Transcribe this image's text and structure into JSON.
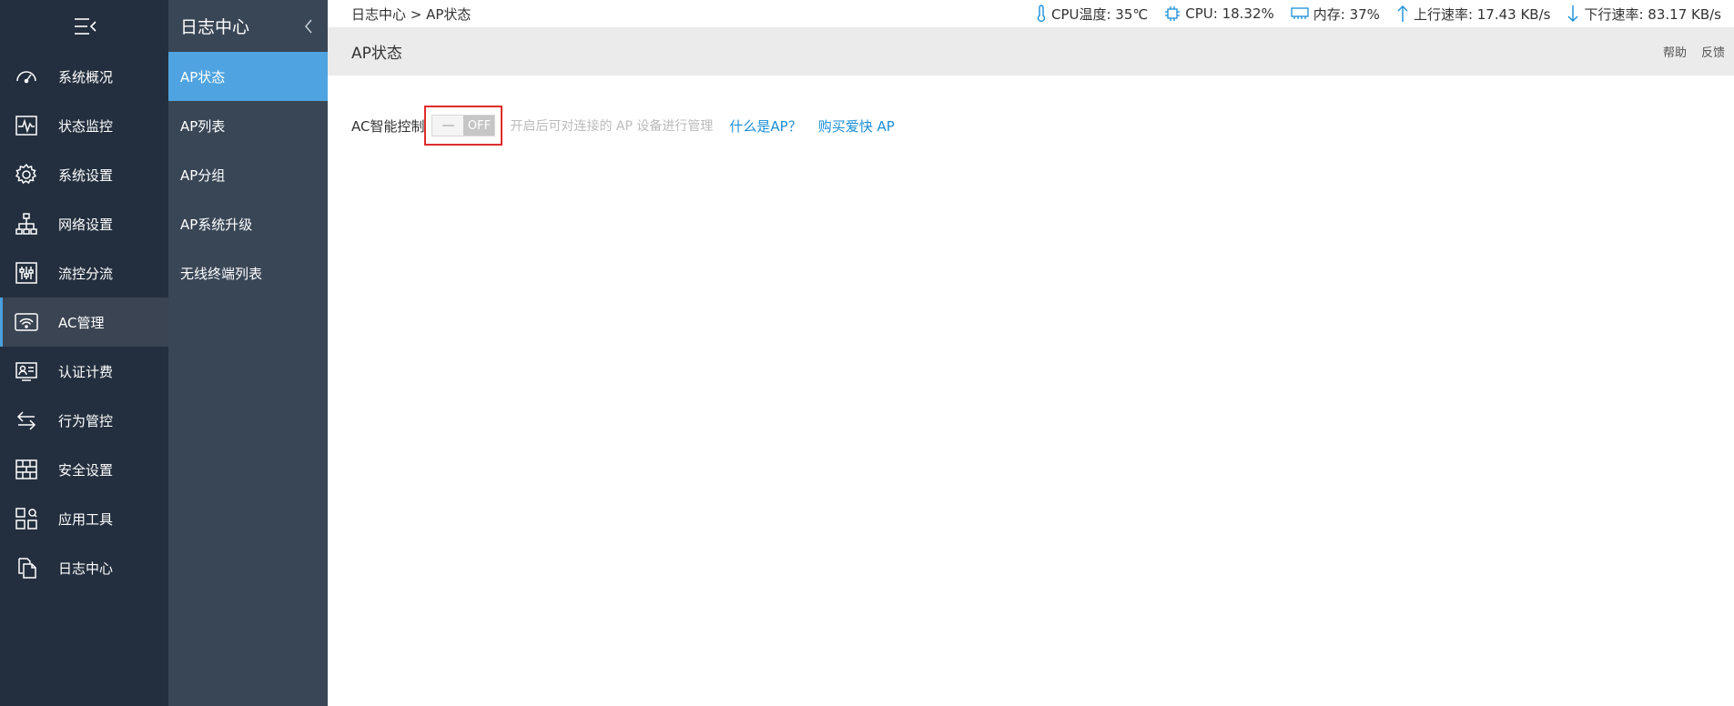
{
  "nav": {
    "toggle_icon": "menu-collapse-icon",
    "items": [
      {
        "label": "系统概况",
        "icon": "speedometer-icon"
      },
      {
        "label": "状态监控",
        "icon": "pulse-monitor-icon"
      },
      {
        "label": "系统设置",
        "icon": "gear-icon"
      },
      {
        "label": "网络设置",
        "icon": "network-tree-icon"
      },
      {
        "label": "流控分流",
        "icon": "sliders-icon"
      },
      {
        "label": "AC管理",
        "icon": "wifi-router-icon"
      },
      {
        "label": "认证计费",
        "icon": "id-card-icon"
      },
      {
        "label": "行为管控",
        "icon": "swap-arrows-icon"
      },
      {
        "label": "安全设置",
        "icon": "firewall-icon"
      },
      {
        "label": "应用工具",
        "icon": "apps-tools-icon"
      },
      {
        "label": "日志中心",
        "icon": "documents-icon"
      }
    ],
    "active_index": 5
  },
  "subnav": {
    "title": "日志中心",
    "items": [
      {
        "label": "AP状态"
      },
      {
        "label": "AP列表"
      },
      {
        "label": "AP分组"
      },
      {
        "label": "AP系统升级"
      },
      {
        "label": "无线终端列表"
      }
    ],
    "active_index": 0
  },
  "topbar": {
    "breadcrumb": "日志中心 > AP状态",
    "cpu_temp": "CPU温度: 35℃",
    "cpu": "CPU: 18.32%",
    "memory": "内存: 37%",
    "upload": "上行速率: 17.43 KB/s",
    "download": "下行速率: 83.17 KB/s"
  },
  "page": {
    "title": "AP状态",
    "help": "帮助",
    "feedback": "反馈"
  },
  "ac_control": {
    "label": "AC智能控制",
    "switch_on_glyph": "—",
    "switch_off_text": "OFF",
    "state": "off",
    "hint": "开启后可对连接的 AP 设备进行管理",
    "link_what_is_ap": "什么是AP？",
    "link_buy_ap": "购买爱快 AP"
  },
  "colors": {
    "nav_bg": "#232f3e",
    "subnav_bg": "#394656",
    "active_blue": "#4fa3e0",
    "link_blue": "#1a8fd8",
    "highlight_red": "#e02b2b"
  }
}
